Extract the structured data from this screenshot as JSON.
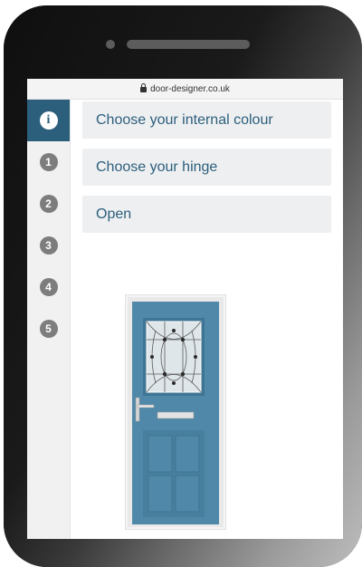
{
  "browser": {
    "url": "door-designer.co.uk"
  },
  "sidebar": {
    "steps": [
      {
        "label": "i",
        "active": true
      },
      {
        "label": "1"
      },
      {
        "label": "2"
      },
      {
        "label": "3"
      },
      {
        "label": "4"
      },
      {
        "label": "5"
      }
    ]
  },
  "options": [
    {
      "label": "Choose your internal colour"
    },
    {
      "label": "Choose your hinge"
    },
    {
      "label": "Open"
    }
  ],
  "door": {
    "color": "#4f88a8",
    "frame_color": "#f5f5f5"
  },
  "colors": {
    "accent": "#2c5f7c",
    "inactive_step": "#7d7d7d",
    "option_bg": "#eeeff1"
  }
}
